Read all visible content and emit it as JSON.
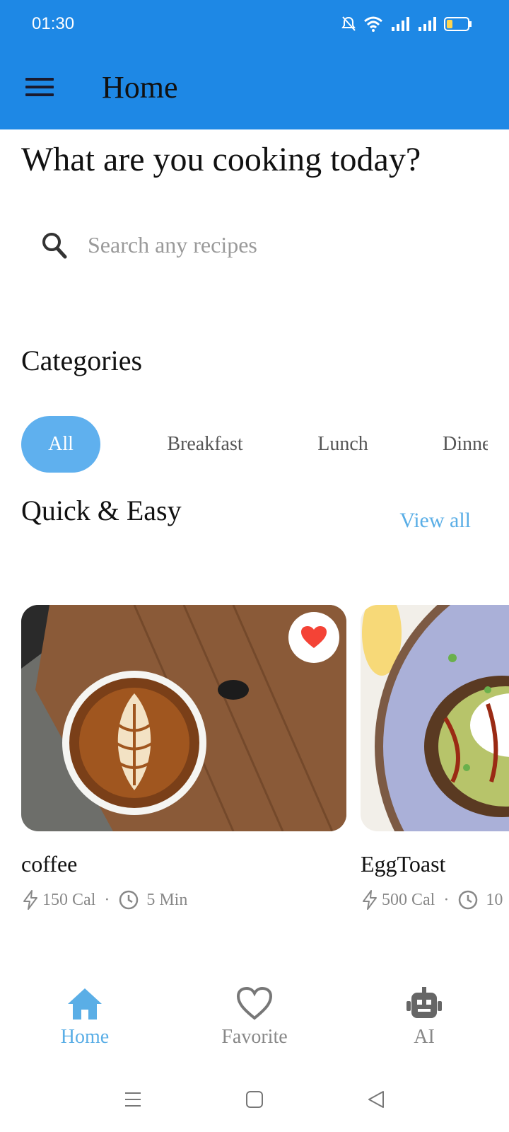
{
  "status_bar": {
    "time": "01:30"
  },
  "app_bar": {
    "title": "Home"
  },
  "headline": "What are you cooking today?",
  "search": {
    "placeholder": "Search any recipes"
  },
  "categories": {
    "title": "Categories",
    "items": [
      "All",
      "Breakfast",
      "Lunch",
      "Dinner"
    ],
    "selected": "All"
  },
  "quick_easy": {
    "title": "Quick & Easy",
    "view_all": "View all",
    "recipes": [
      {
        "name": "coffee",
        "calories": "150 Cal",
        "time": "5 Min",
        "favorite": true
      },
      {
        "name": "EggToast",
        "calories": "500 Cal",
        "time": "10",
        "favorite": false
      }
    ]
  },
  "bottom_nav": {
    "items": [
      {
        "label": "Home",
        "icon": "home-icon",
        "active": true
      },
      {
        "label": "Favorite",
        "icon": "heart-outline-icon",
        "active": false
      },
      {
        "label": "AI",
        "icon": "robot-icon",
        "active": false
      }
    ]
  },
  "colors": {
    "primary": "#1e88e5",
    "accent": "#5fb0ee",
    "favorite": "#f44336",
    "muted": "#888888"
  }
}
